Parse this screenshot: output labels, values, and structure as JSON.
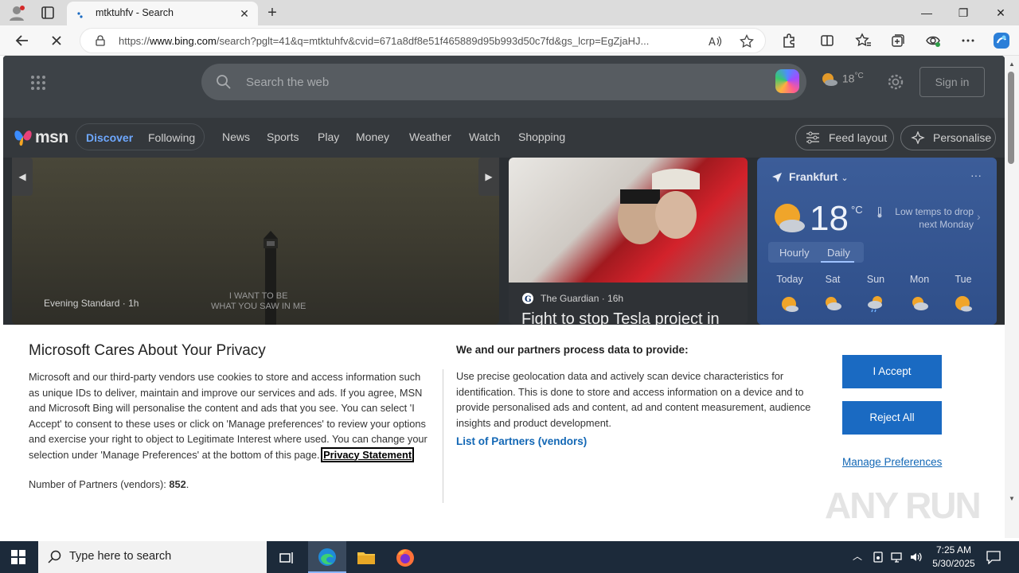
{
  "browser": {
    "tab_title": "mtktuhfv - Search",
    "tab_close": "✕",
    "new_tab": "+",
    "window_controls": {
      "minimize": "—",
      "restore": "❐",
      "close": "✕"
    },
    "url_prefix": "https://",
    "url_domain": "www.bing.com",
    "url_rest": "/search?pglt=41&q=mtktuhfv&cvid=671a8df8e51f465889d95b993d50c7fd&gs_lcrp=EgZjaHJ..."
  },
  "bing": {
    "search_placeholder": "Search the web",
    "weather_temp": "18",
    "weather_unit": "°C",
    "sign_in": "Sign in"
  },
  "msn": {
    "logo": "msn",
    "discover": "Discover",
    "following": "Following",
    "nav": [
      "News",
      "Sports",
      "Play",
      "Money",
      "Weather",
      "Watch",
      "Shopping"
    ],
    "feed_layout": "Feed layout",
    "personalise": "Personalise"
  },
  "cards": {
    "hero_source": "Evening Standard · 1h",
    "hero_overlay_line1": "I WANT TO BE",
    "hero_overlay_line2": "WHAT YOU SAW IN ME",
    "second_source": "The Guardian · 16h",
    "second_headline": "Fight to stop Tesla project in"
  },
  "weather_card": {
    "city": "Frankfurt",
    "temp": "18",
    "unit": "°C",
    "message": "Low temps to drop next Monday",
    "tab_hourly": "Hourly",
    "tab_daily": "Daily",
    "days": [
      "Today",
      "Sat",
      "Sun",
      "Mon",
      "Tue"
    ]
  },
  "privacy": {
    "title": "Microsoft Cares About Your Privacy",
    "body": "Microsoft and our third-party vendors use cookies to store and access information such as unique IDs to deliver, maintain and improve our services and ads. If you agree, MSN and Microsoft Bing will personalise the content and ads that you see. You can select 'I Accept' to consent to these uses or click on 'Manage preferences' to review your options and exercise your right to object to Legitimate Interest where used.  You can change your selection under 'Manage Preferences' at the bottom of this page.",
    "privacy_link": "Privacy Statement",
    "partners_label": "Number of Partners (vendors): ",
    "partners_count": "852",
    "partners_suffix": ".",
    "purpose_heading": "We and our partners process data to provide:",
    "purpose_text": "Use precise geolocation data and actively scan device characteristics for identification. This is done to store and access information on a device and to provide personalised ads and content, ad and content measurement, audience insights and product development.",
    "vendors_link": "List of Partners (vendors)",
    "accept": "I Accept",
    "reject": "Reject All",
    "manage": "Manage Preferences"
  },
  "watermark": "ANY RUN",
  "taskbar": {
    "search_placeholder": "Type here to search",
    "time": "7:25 AM",
    "date": "5/30/2025"
  },
  "colors": {
    "accent_blue": "#1a6ac2",
    "link_blue": "#1267b5",
    "msn_discover": "#6ea8ff"
  }
}
